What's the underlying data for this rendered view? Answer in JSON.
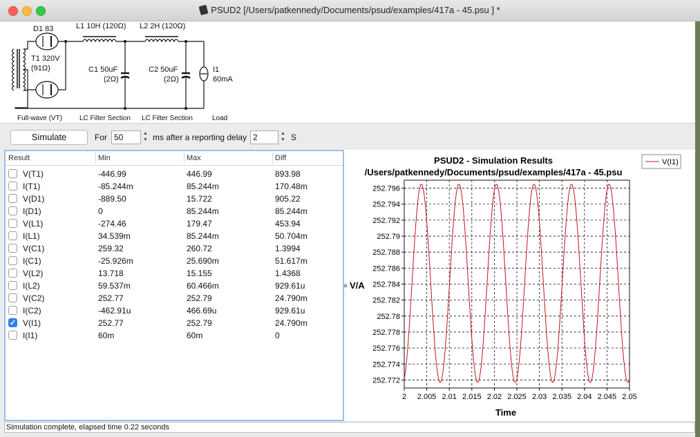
{
  "window": {
    "title": "PSUD2  [/Users/patkennedy/Documents/psud/examples/417a - 45.psu ] *",
    "traffic_lights": {
      "close": "#fc605b",
      "minimize": "#fdbc40",
      "zoom": "#34c84a"
    }
  },
  "schematic": {
    "rectifier_label": "D1 83",
    "transformer_label": "T1 320V",
    "transformer_resistance": "(91Ω)",
    "l1_label": "L1 10H (120Ω)",
    "l2_label": "L2 2H (120Ω)",
    "c1_label": "C1 50uF",
    "c1_esr": "(2Ω)",
    "c2_label": "C2 50uF",
    "c2_esr": "(2Ω)",
    "load_label": "I1",
    "load_value": "60mA",
    "section1_caption": "Full-wave (VT)",
    "section2_caption": "LC Filter Section",
    "section3_caption": "LC Filter Section",
    "section4_caption": "Load"
  },
  "toolbar": {
    "simulate_label": "Simulate",
    "for_label": "For",
    "duration_value": "50",
    "after_label": "ms  after a reporting delay",
    "delay_value": "2",
    "delay_unit": "S"
  },
  "table": {
    "headers": [
      "Result",
      "Min",
      "Max",
      "Diff"
    ],
    "rows": [
      {
        "name": "V(T1)",
        "checked": false,
        "min": "-446.99",
        "max": "446.99",
        "diff": "893.98"
      },
      {
        "name": "I(T1)",
        "checked": false,
        "min": "-85.244m",
        "max": "85.244m",
        "diff": "170.48m"
      },
      {
        "name": "V(D1)",
        "checked": false,
        "min": "-889.50",
        "max": "15.722",
        "diff": "905.22"
      },
      {
        "name": "I(D1)",
        "checked": false,
        "min": "0",
        "max": "85.244m",
        "diff": "85.244m"
      },
      {
        "name": "V(L1)",
        "checked": false,
        "min": "-274.46",
        "max": "179.47",
        "diff": "453.94"
      },
      {
        "name": "I(L1)",
        "checked": false,
        "min": "34.539m",
        "max": "85.244m",
        "diff": "50.704m"
      },
      {
        "name": "V(C1)",
        "checked": false,
        "min": "259.32",
        "max": "260.72",
        "diff": "1.3994"
      },
      {
        "name": "I(C1)",
        "checked": false,
        "min": "-25.926m",
        "max": "25.690m",
        "diff": "51.617m"
      },
      {
        "name": "V(L2)",
        "checked": false,
        "min": "13.718",
        "max": "15.155",
        "diff": "1.4368"
      },
      {
        "name": "I(L2)",
        "checked": false,
        "min": "59.537m",
        "max": "60.466m",
        "diff": "929.61u"
      },
      {
        "name": "V(C2)",
        "checked": false,
        "min": "252.77",
        "max": "252.79",
        "diff": "24.790m"
      },
      {
        "name": "I(C2)",
        "checked": false,
        "min": "-462.91u",
        "max": "466.69u",
        "diff": "929.61u"
      },
      {
        "name": "V(I1)",
        "checked": true,
        "min": "252.77",
        "max": "252.79",
        "diff": "24.790m"
      },
      {
        "name": "I(I1)",
        "checked": false,
        "min": "60m",
        "max": "60m",
        "diff": "0"
      }
    ]
  },
  "chart_data": {
    "type": "line",
    "title": "PSUD2 - Simulation Results",
    "subtitle": "/Users/patkennedy/Documents/psud/examples/417a - 45.psu",
    "xlabel": "Time",
    "ylabel": "V/A",
    "xlim": [
      2,
      2.05
    ],
    "ylim": [
      252.771,
      252.797
    ],
    "x_ticks": [
      "2",
      "2.005",
      "2.01",
      "2.015",
      "2.02",
      "2.025",
      "2.03",
      "2.035",
      "2.04",
      "2.045",
      "2.05"
    ],
    "y_ticks": [
      "252.796",
      "252.794",
      "252.792",
      "252.79",
      "252.788",
      "252.786",
      "252.784",
      "252.782",
      "252.78",
      "252.778",
      "252.776",
      "252.774",
      "252.772"
    ],
    "grid": true,
    "legend_position": "top-right",
    "series": [
      {
        "name": "V(I1)",
        "color": "#c0141c",
        "waveform": "sine",
        "period": 0.008333,
        "peaks_x": [
          2.0038,
          2.0121,
          2.0205,
          2.0288,
          2.0371,
          2.0455
        ],
        "max": 252.7965,
        "min": 252.7717
      }
    ]
  },
  "status": {
    "text": "Simulation complete, elapsed time 0.22 seconds"
  }
}
